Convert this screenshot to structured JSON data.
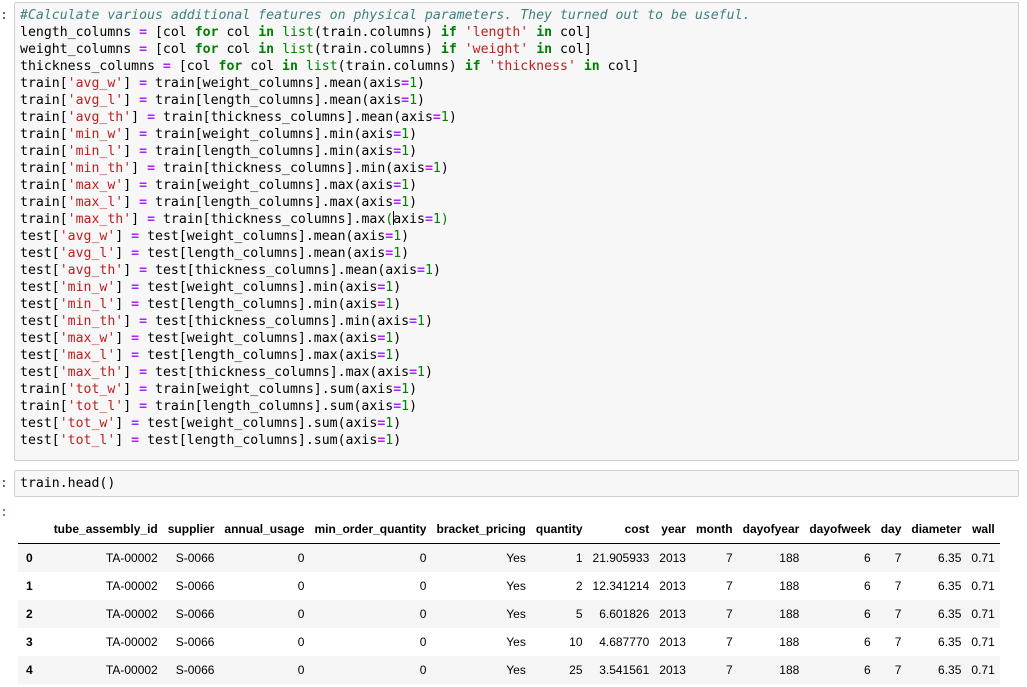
{
  "cells": {
    "code1": {
      "prompt": ":",
      "lines": [
        [
          [
            "cm",
            "#Calculate various additional features on physical parameters. They turned out to be useful."
          ]
        ],
        [
          [
            "plain",
            "length_columns "
          ],
          [
            "op",
            "="
          ],
          [
            "plain",
            " [col "
          ],
          [
            "kw",
            "for"
          ],
          [
            "plain",
            " col "
          ],
          [
            "kw",
            "in"
          ],
          [
            "plain",
            " "
          ],
          [
            "bi",
            "list"
          ],
          [
            "plain",
            "(train.columns) "
          ],
          [
            "kw",
            "if"
          ],
          [
            "plain",
            " "
          ],
          [
            "str",
            "'length'"
          ],
          [
            "plain",
            " "
          ],
          [
            "kw",
            "in"
          ],
          [
            "plain",
            " col]"
          ]
        ],
        [
          [
            "plain",
            "weight_columns "
          ],
          [
            "op",
            "="
          ],
          [
            "plain",
            " [col "
          ],
          [
            "kw",
            "for"
          ],
          [
            "plain",
            " col "
          ],
          [
            "kw",
            "in"
          ],
          [
            "plain",
            " "
          ],
          [
            "bi",
            "list"
          ],
          [
            "plain",
            "(train.columns) "
          ],
          [
            "kw",
            "if"
          ],
          [
            "plain",
            " "
          ],
          [
            "str",
            "'weight'"
          ],
          [
            "plain",
            " "
          ],
          [
            "kw",
            "in"
          ],
          [
            "plain",
            " col]"
          ]
        ],
        [
          [
            "plain",
            "thickness_columns "
          ],
          [
            "op",
            "="
          ],
          [
            "plain",
            " [col "
          ],
          [
            "kw",
            "for"
          ],
          [
            "plain",
            " col "
          ],
          [
            "kw",
            "in"
          ],
          [
            "plain",
            " "
          ],
          [
            "bi",
            "list"
          ],
          [
            "plain",
            "(train.columns) "
          ],
          [
            "kw",
            "if"
          ],
          [
            "plain",
            " "
          ],
          [
            "str",
            "'thickness'"
          ],
          [
            "plain",
            " "
          ],
          [
            "kw",
            "in"
          ],
          [
            "plain",
            " col]"
          ]
        ],
        [
          [
            "plain",
            "train["
          ],
          [
            "str",
            "'avg_w'"
          ],
          [
            "plain",
            "] "
          ],
          [
            "op",
            "="
          ],
          [
            "plain",
            " train[weight_columns].mean(axis"
          ],
          [
            "op",
            "="
          ],
          [
            "num",
            "1"
          ],
          [
            "plain",
            ")"
          ]
        ],
        [
          [
            "plain",
            "train["
          ],
          [
            "str",
            "'avg_l'"
          ],
          [
            "plain",
            "] "
          ],
          [
            "op",
            "="
          ],
          [
            "plain",
            " train[length_columns].mean(axis"
          ],
          [
            "op",
            "="
          ],
          [
            "num",
            "1"
          ],
          [
            "plain",
            ")"
          ]
        ],
        [
          [
            "plain",
            "train["
          ],
          [
            "str",
            "'avg_th'"
          ],
          [
            "plain",
            "] "
          ],
          [
            "op",
            "="
          ],
          [
            "plain",
            " train[thickness_columns].mean(axis"
          ],
          [
            "op",
            "="
          ],
          [
            "num",
            "1"
          ],
          [
            "plain",
            ")"
          ]
        ],
        [
          [
            "plain",
            "train["
          ],
          [
            "str",
            "'min_w'"
          ],
          [
            "plain",
            "] "
          ],
          [
            "op",
            "="
          ],
          [
            "plain",
            " train[weight_columns].min(axis"
          ],
          [
            "op",
            "="
          ],
          [
            "num",
            "1"
          ],
          [
            "plain",
            ")"
          ]
        ],
        [
          [
            "plain",
            "train["
          ],
          [
            "str",
            "'min_l'"
          ],
          [
            "plain",
            "] "
          ],
          [
            "op",
            "="
          ],
          [
            "plain",
            " train[length_columns].min(axis"
          ],
          [
            "op",
            "="
          ],
          [
            "num",
            "1"
          ],
          [
            "plain",
            ")"
          ]
        ],
        [
          [
            "plain",
            "train["
          ],
          [
            "str",
            "'min_th'"
          ],
          [
            "plain",
            "] "
          ],
          [
            "op",
            "="
          ],
          [
            "plain",
            " train[thickness_columns].min(axis"
          ],
          [
            "op",
            "="
          ],
          [
            "num",
            "1"
          ],
          [
            "plain",
            ")"
          ]
        ],
        [
          [
            "plain",
            "train["
          ],
          [
            "str",
            "'max_w'"
          ],
          [
            "plain",
            "] "
          ],
          [
            "op",
            "="
          ],
          [
            "plain",
            " train[weight_columns].max(axis"
          ],
          [
            "op",
            "="
          ],
          [
            "num",
            "1"
          ],
          [
            "plain",
            ")"
          ]
        ],
        [
          [
            "plain",
            "train["
          ],
          [
            "str",
            "'max_l'"
          ],
          [
            "plain",
            "] "
          ],
          [
            "op",
            "="
          ],
          [
            "plain",
            " train[length_columns].max(axis"
          ],
          [
            "op",
            "="
          ],
          [
            "num",
            "1"
          ],
          [
            "plain",
            ")"
          ]
        ],
        [
          [
            "plain",
            "train["
          ],
          [
            "str",
            "'max_th'"
          ],
          [
            "plain",
            "] "
          ],
          [
            "op",
            "="
          ],
          [
            "plain",
            " train[thickness_columns].max"
          ],
          [
            "bi",
            "("
          ],
          [
            "cursor",
            ""
          ],
          [
            "plain",
            "axis"
          ],
          [
            "op",
            "="
          ],
          [
            "num",
            "1"
          ],
          [
            "bi",
            ")"
          ]
        ],
        [
          [
            "plain",
            "test["
          ],
          [
            "str",
            "'avg_w'"
          ],
          [
            "plain",
            "] "
          ],
          [
            "op",
            "="
          ],
          [
            "plain",
            " test[weight_columns].mean(axis"
          ],
          [
            "op",
            "="
          ],
          [
            "num",
            "1"
          ],
          [
            "plain",
            ")"
          ]
        ],
        [
          [
            "plain",
            "test["
          ],
          [
            "str",
            "'avg_l'"
          ],
          [
            "plain",
            "] "
          ],
          [
            "op",
            "="
          ],
          [
            "plain",
            " test[length_columns].mean(axis"
          ],
          [
            "op",
            "="
          ],
          [
            "num",
            "1"
          ],
          [
            "plain",
            ")"
          ]
        ],
        [
          [
            "plain",
            "test["
          ],
          [
            "str",
            "'avg_th'"
          ],
          [
            "plain",
            "] "
          ],
          [
            "op",
            "="
          ],
          [
            "plain",
            " test[thickness_columns].mean(axis"
          ],
          [
            "op",
            "="
          ],
          [
            "num",
            "1"
          ],
          [
            "plain",
            ")"
          ]
        ],
        [
          [
            "plain",
            "test["
          ],
          [
            "str",
            "'min_w'"
          ],
          [
            "plain",
            "] "
          ],
          [
            "op",
            "="
          ],
          [
            "plain",
            " test[weight_columns].min(axis"
          ],
          [
            "op",
            "="
          ],
          [
            "num",
            "1"
          ],
          [
            "plain",
            ")"
          ]
        ],
        [
          [
            "plain",
            "test["
          ],
          [
            "str",
            "'min_l'"
          ],
          [
            "plain",
            "] "
          ],
          [
            "op",
            "="
          ],
          [
            "plain",
            " test[length_columns].min(axis"
          ],
          [
            "op",
            "="
          ],
          [
            "num",
            "1"
          ],
          [
            "plain",
            ")"
          ]
        ],
        [
          [
            "plain",
            "test["
          ],
          [
            "str",
            "'min_th'"
          ],
          [
            "plain",
            "] "
          ],
          [
            "op",
            "="
          ],
          [
            "plain",
            " test[thickness_columns].min(axis"
          ],
          [
            "op",
            "="
          ],
          [
            "num",
            "1"
          ],
          [
            "plain",
            ")"
          ]
        ],
        [
          [
            "plain",
            "test["
          ],
          [
            "str",
            "'max_w'"
          ],
          [
            "plain",
            "] "
          ],
          [
            "op",
            "="
          ],
          [
            "plain",
            " test[weight_columns].max(axis"
          ],
          [
            "op",
            "="
          ],
          [
            "num",
            "1"
          ],
          [
            "plain",
            ")"
          ]
        ],
        [
          [
            "plain",
            "test["
          ],
          [
            "str",
            "'max_l'"
          ],
          [
            "plain",
            "] "
          ],
          [
            "op",
            "="
          ],
          [
            "plain",
            " test[length_columns].max(axis"
          ],
          [
            "op",
            "="
          ],
          [
            "num",
            "1"
          ],
          [
            "plain",
            ")"
          ]
        ],
        [
          [
            "plain",
            "test["
          ],
          [
            "str",
            "'max_th'"
          ],
          [
            "plain",
            "] "
          ],
          [
            "op",
            "="
          ],
          [
            "plain",
            " test[thickness_columns].max(axis"
          ],
          [
            "op",
            "="
          ],
          [
            "num",
            "1"
          ],
          [
            "plain",
            ")"
          ]
        ],
        [
          [
            "plain",
            "train["
          ],
          [
            "str",
            "'tot_w'"
          ],
          [
            "plain",
            "] "
          ],
          [
            "op",
            "="
          ],
          [
            "plain",
            " train[weight_columns].sum(axis"
          ],
          [
            "op",
            "="
          ],
          [
            "num",
            "1"
          ],
          [
            "plain",
            ")"
          ]
        ],
        [
          [
            "plain",
            "train["
          ],
          [
            "str",
            "'tot_l'"
          ],
          [
            "plain",
            "] "
          ],
          [
            "op",
            "="
          ],
          [
            "plain",
            " train[length_columns].sum(axis"
          ],
          [
            "op",
            "="
          ],
          [
            "num",
            "1"
          ],
          [
            "plain",
            ")"
          ]
        ],
        [
          [
            "plain",
            "test["
          ],
          [
            "str",
            "'tot_w'"
          ],
          [
            "plain",
            "] "
          ],
          [
            "op",
            "="
          ],
          [
            "plain",
            " test[weight_columns].sum(axis"
          ],
          [
            "op",
            "="
          ],
          [
            "num",
            "1"
          ],
          [
            "plain",
            ")"
          ]
        ],
        [
          [
            "plain",
            "test["
          ],
          [
            "str",
            "'tot_l'"
          ],
          [
            "plain",
            "] "
          ],
          [
            "op",
            "="
          ],
          [
            "plain",
            " test[length_columns].sum(axis"
          ],
          [
            "op",
            "="
          ],
          [
            "num",
            "1"
          ],
          [
            "plain",
            ")"
          ]
        ]
      ]
    },
    "code2": {
      "prompt": ":",
      "lines": [
        [
          [
            "plain",
            "train.head()"
          ]
        ]
      ]
    },
    "output": {
      "prompt": ":",
      "columns": [
        "tube_assembly_id",
        "supplier",
        "annual_usage",
        "min_order_quantity",
        "bracket_pricing",
        "quantity",
        "cost",
        "year",
        "month",
        "dayofyear",
        "dayofweek",
        "day",
        "diameter",
        "wall"
      ],
      "rows": [
        {
          "index": "0",
          "cells": [
            "TA-00002",
            "S-0066",
            "0",
            "0",
            "Yes",
            "1",
            "21.905933",
            "2013",
            "7",
            "188",
            "6",
            "7",
            "6.35",
            "0.71"
          ]
        },
        {
          "index": "1",
          "cells": [
            "TA-00002",
            "S-0066",
            "0",
            "0",
            "Yes",
            "2",
            "12.341214",
            "2013",
            "7",
            "188",
            "6",
            "7",
            "6.35",
            "0.71"
          ]
        },
        {
          "index": "2",
          "cells": [
            "TA-00002",
            "S-0066",
            "0",
            "0",
            "Yes",
            "5",
            "6.601826",
            "2013",
            "7",
            "188",
            "6",
            "7",
            "6.35",
            "0.71"
          ]
        },
        {
          "index": "3",
          "cells": [
            "TA-00002",
            "S-0066",
            "0",
            "0",
            "Yes",
            "10",
            "4.687770",
            "2013",
            "7",
            "188",
            "6",
            "7",
            "6.35",
            "0.71"
          ]
        },
        {
          "index": "4",
          "cells": [
            "TA-00002",
            "S-0066",
            "0",
            "0",
            "Yes",
            "25",
            "3.541561",
            "2013",
            "7",
            "188",
            "6",
            "7",
            "6.35",
            "0.71"
          ]
        }
      ]
    }
  },
  "colors": {
    "keyword": "#008000",
    "string": "#ba2121",
    "number": "#008000",
    "operator": "#aa22ff",
    "comment": "#408080",
    "prompt": "#303f9f",
    "cell_background": "#f7f7f7",
    "row_stripe": "#f5f5f5"
  }
}
